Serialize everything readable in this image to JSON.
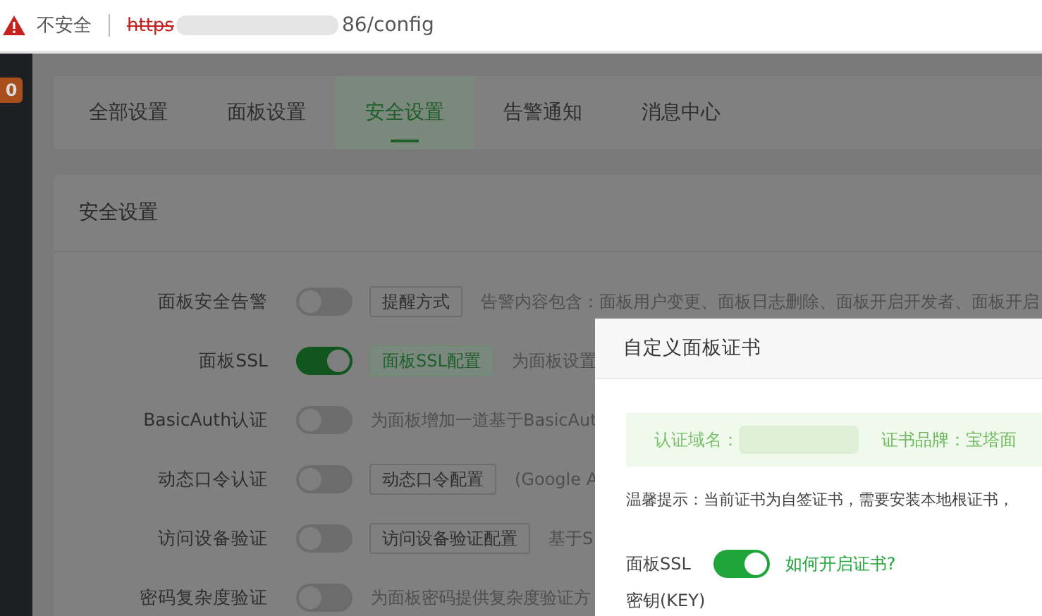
{
  "browser": {
    "security": "不安全",
    "url_struck": "https",
    "url_rest": "86/config"
  },
  "sidebar": {
    "badge": "0"
  },
  "tabs": [
    {
      "label": "全部设置",
      "selected": false
    },
    {
      "label": "面板设置",
      "selected": false
    },
    {
      "label": "安全设置",
      "selected": true
    },
    {
      "label": "告警通知",
      "selected": false
    },
    {
      "label": "消息中心",
      "selected": false
    }
  ],
  "section_title": "安全设置",
  "settings": [
    {
      "label": "面板安全告警",
      "on": false,
      "button": "提醒方式",
      "description": "告警内容包含：面板用户变更、面板日志删除、面板开启开发者、面板开启"
    },
    {
      "label": "面板SSL",
      "on": true,
      "button": "面板SSL配置",
      "description": "为面板设置"
    },
    {
      "label": "BasicAuth认证",
      "on": false,
      "description": "为面板增加一道基于BasicAut"
    },
    {
      "label": "动态口令认证",
      "on": false,
      "button": "动态口令配置",
      "description": "(Google A"
    },
    {
      "label": "访问设备验证",
      "on": false,
      "button": "访问设备验证配置",
      "description": "基于S"
    },
    {
      "label": "密码复杂度验证",
      "on": false,
      "description": "为面板密码提供复杂度验证方"
    }
  ],
  "modal": {
    "title": "自定义面板证书",
    "domain_label": "认证域名：",
    "brand": "证书品牌：宝塔面",
    "tip": "温馨提示：当前证书为自签证书，需要安装本地根证书，",
    "ssl_label": "面板SSL",
    "ssl_on": true,
    "help_link": "如何开启证书?",
    "key_label": "密钥(KEY)"
  }
}
